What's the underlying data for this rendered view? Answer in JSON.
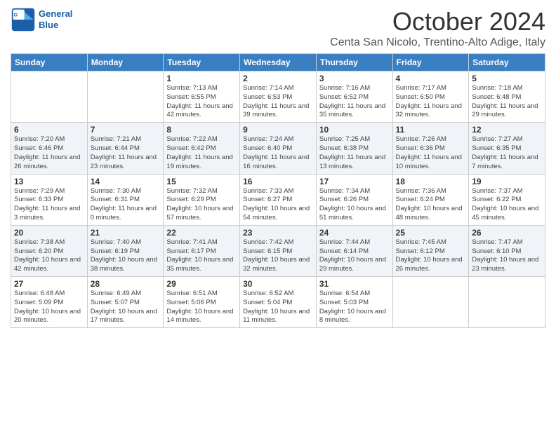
{
  "logo": {
    "general": "General",
    "blue": "Blue"
  },
  "header": {
    "month": "October 2024",
    "location": "Centa San Nicolo, Trentino-Alto Adige, Italy"
  },
  "weekdays": [
    "Sunday",
    "Monday",
    "Tuesday",
    "Wednesday",
    "Thursday",
    "Friday",
    "Saturday"
  ],
  "weeks": [
    [
      {
        "day": "",
        "info": ""
      },
      {
        "day": "",
        "info": ""
      },
      {
        "day": "1",
        "info": "Sunrise: 7:13 AM\nSunset: 6:55 PM\nDaylight: 11 hours and 42 minutes."
      },
      {
        "day": "2",
        "info": "Sunrise: 7:14 AM\nSunset: 6:53 PM\nDaylight: 11 hours and 39 minutes."
      },
      {
        "day": "3",
        "info": "Sunrise: 7:16 AM\nSunset: 6:52 PM\nDaylight: 11 hours and 35 minutes."
      },
      {
        "day": "4",
        "info": "Sunrise: 7:17 AM\nSunset: 6:50 PM\nDaylight: 11 hours and 32 minutes."
      },
      {
        "day": "5",
        "info": "Sunrise: 7:18 AM\nSunset: 6:48 PM\nDaylight: 11 hours and 29 minutes."
      }
    ],
    [
      {
        "day": "6",
        "info": "Sunrise: 7:20 AM\nSunset: 6:46 PM\nDaylight: 11 hours and 26 minutes."
      },
      {
        "day": "7",
        "info": "Sunrise: 7:21 AM\nSunset: 6:44 PM\nDaylight: 11 hours and 23 minutes."
      },
      {
        "day": "8",
        "info": "Sunrise: 7:22 AM\nSunset: 6:42 PM\nDaylight: 11 hours and 19 minutes."
      },
      {
        "day": "9",
        "info": "Sunrise: 7:24 AM\nSunset: 6:40 PM\nDaylight: 11 hours and 16 minutes."
      },
      {
        "day": "10",
        "info": "Sunrise: 7:25 AM\nSunset: 6:38 PM\nDaylight: 11 hours and 13 minutes."
      },
      {
        "day": "11",
        "info": "Sunrise: 7:26 AM\nSunset: 6:36 PM\nDaylight: 11 hours and 10 minutes."
      },
      {
        "day": "12",
        "info": "Sunrise: 7:27 AM\nSunset: 6:35 PM\nDaylight: 11 hours and 7 minutes."
      }
    ],
    [
      {
        "day": "13",
        "info": "Sunrise: 7:29 AM\nSunset: 6:33 PM\nDaylight: 11 hours and 3 minutes."
      },
      {
        "day": "14",
        "info": "Sunrise: 7:30 AM\nSunset: 6:31 PM\nDaylight: 11 hours and 0 minutes."
      },
      {
        "day": "15",
        "info": "Sunrise: 7:32 AM\nSunset: 6:29 PM\nDaylight: 10 hours and 57 minutes."
      },
      {
        "day": "16",
        "info": "Sunrise: 7:33 AM\nSunset: 6:27 PM\nDaylight: 10 hours and 54 minutes."
      },
      {
        "day": "17",
        "info": "Sunrise: 7:34 AM\nSunset: 6:26 PM\nDaylight: 10 hours and 51 minutes."
      },
      {
        "day": "18",
        "info": "Sunrise: 7:36 AM\nSunset: 6:24 PM\nDaylight: 10 hours and 48 minutes."
      },
      {
        "day": "19",
        "info": "Sunrise: 7:37 AM\nSunset: 6:22 PM\nDaylight: 10 hours and 45 minutes."
      }
    ],
    [
      {
        "day": "20",
        "info": "Sunrise: 7:38 AM\nSunset: 6:20 PM\nDaylight: 10 hours and 42 minutes."
      },
      {
        "day": "21",
        "info": "Sunrise: 7:40 AM\nSunset: 6:19 PM\nDaylight: 10 hours and 38 minutes."
      },
      {
        "day": "22",
        "info": "Sunrise: 7:41 AM\nSunset: 6:17 PM\nDaylight: 10 hours and 35 minutes."
      },
      {
        "day": "23",
        "info": "Sunrise: 7:42 AM\nSunset: 6:15 PM\nDaylight: 10 hours and 32 minutes."
      },
      {
        "day": "24",
        "info": "Sunrise: 7:44 AM\nSunset: 6:14 PM\nDaylight: 10 hours and 29 minutes."
      },
      {
        "day": "25",
        "info": "Sunrise: 7:45 AM\nSunset: 6:12 PM\nDaylight: 10 hours and 26 minutes."
      },
      {
        "day": "26",
        "info": "Sunrise: 7:47 AM\nSunset: 6:10 PM\nDaylight: 10 hours and 23 minutes."
      }
    ],
    [
      {
        "day": "27",
        "info": "Sunrise: 6:48 AM\nSunset: 5:09 PM\nDaylight: 10 hours and 20 minutes."
      },
      {
        "day": "28",
        "info": "Sunrise: 6:49 AM\nSunset: 5:07 PM\nDaylight: 10 hours and 17 minutes."
      },
      {
        "day": "29",
        "info": "Sunrise: 6:51 AM\nSunset: 5:06 PM\nDaylight: 10 hours and 14 minutes."
      },
      {
        "day": "30",
        "info": "Sunrise: 6:52 AM\nSunset: 5:04 PM\nDaylight: 10 hours and 11 minutes."
      },
      {
        "day": "31",
        "info": "Sunrise: 6:54 AM\nSunset: 5:03 PM\nDaylight: 10 hours and 8 minutes."
      },
      {
        "day": "",
        "info": ""
      },
      {
        "day": "",
        "info": ""
      }
    ]
  ]
}
